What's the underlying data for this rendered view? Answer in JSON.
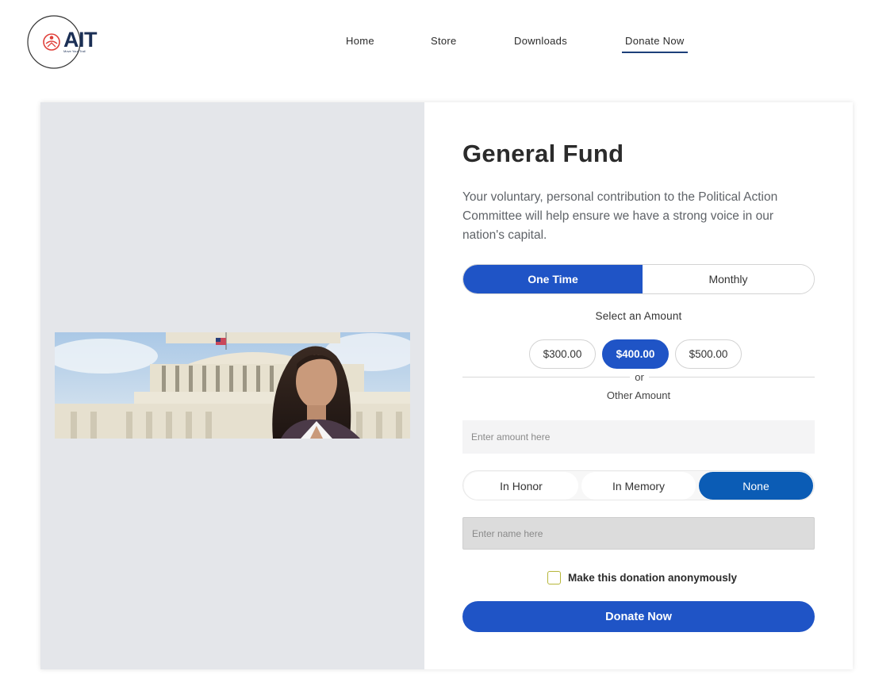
{
  "header": {
    "logo_text": "AIT",
    "logo_tagline": "Move Your Trail",
    "nav": [
      {
        "label": "Home"
      },
      {
        "label": "Store"
      },
      {
        "label": "Downloads"
      },
      {
        "label": "Donate Now"
      }
    ],
    "active_nav": "Donate Now"
  },
  "form": {
    "title": "General Fund",
    "description": "Your voluntary, personal contribution to the Political Action Committee will help ensure we have a strong voice in our nation's capital.",
    "frequency": {
      "options": [
        "One Time",
        "Monthly"
      ],
      "selected": "One Time"
    },
    "select_amount_label": "Select an Amount",
    "amounts": [
      "$300.00",
      "$400.00",
      "$500.00"
    ],
    "selected_amount": "$400.00",
    "or_label": "or",
    "other_amount_label": "Other Amount",
    "amount_placeholder": "Enter amount here",
    "tribute": {
      "options": [
        "In Honor",
        "In Memory",
        "None"
      ],
      "selected": "None"
    },
    "name_placeholder": "Enter name here",
    "anonymous_label": "Make this donation anonymously",
    "anonymous_checked": false,
    "submit_label": "Donate Now"
  },
  "colors": {
    "primary": "#1f54c6",
    "tribute_selected": "#0b5cb5",
    "panel_bg": "#e4e6ea",
    "logo_accent": "#e0403a",
    "logo_text": "#1b2f55"
  }
}
